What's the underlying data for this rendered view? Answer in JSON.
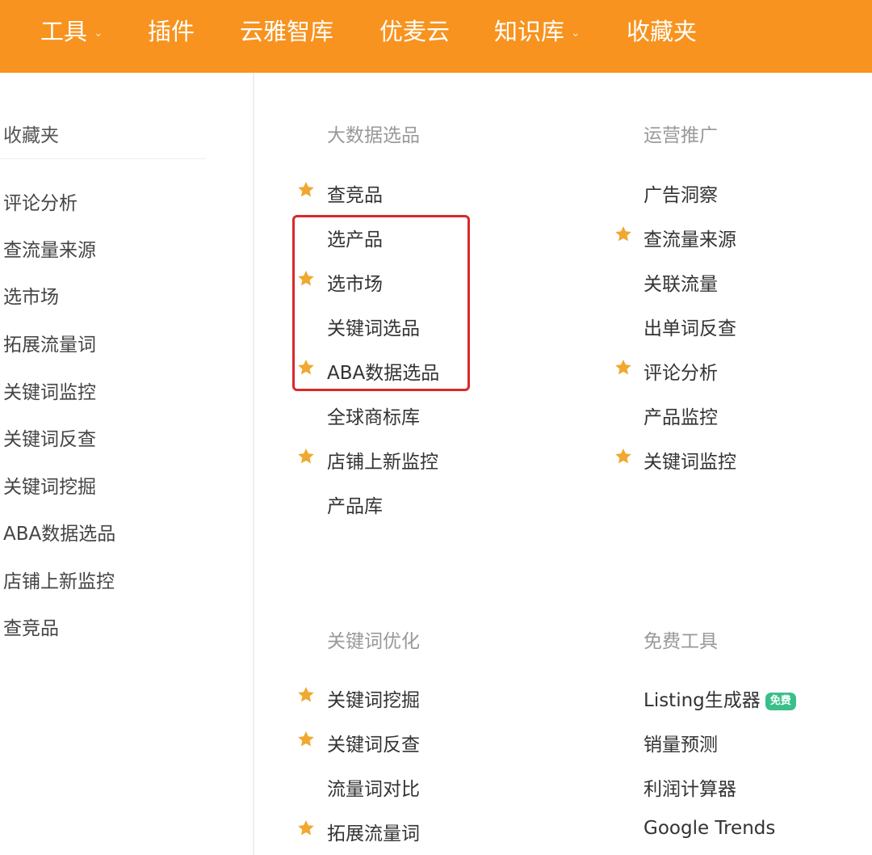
{
  "nav": {
    "items": [
      {
        "label": "工具",
        "dropdown": true
      },
      {
        "label": "插件",
        "dropdown": false
      },
      {
        "label": "云雅智库",
        "dropdown": false
      },
      {
        "label": "优麦云",
        "dropdown": false
      },
      {
        "label": "知识库",
        "dropdown": true
      },
      {
        "label": "收藏夹",
        "dropdown": false
      }
    ],
    "caret": "⌄",
    "bg_color": "#f7931e"
  },
  "favorites": {
    "title": "收藏夹",
    "items": [
      "评论分析",
      "查流量来源",
      "选市场",
      "拓展流量词",
      "关键词监控",
      "关键词反查",
      "关键词挖掘",
      "ABA数据选品",
      "店铺上新监控",
      "查竞品"
    ]
  },
  "sections": [
    {
      "title": "大数据选品",
      "items": [
        {
          "label": "查竞品",
          "starred": true
        },
        {
          "label": "选产品",
          "starred": false
        },
        {
          "label": "选市场",
          "starred": true
        },
        {
          "label": "关键词选品",
          "starred": false
        },
        {
          "label": "ABA数据选品",
          "starred": true
        },
        {
          "label": "全球商标库",
          "starred": false
        },
        {
          "label": "店铺上新监控",
          "starred": true
        },
        {
          "label": "产品库",
          "starred": false
        }
      ]
    },
    {
      "title": "运营推广",
      "items": [
        {
          "label": "广告洞察",
          "starred": false
        },
        {
          "label": "查流量来源",
          "starred": true
        },
        {
          "label": "关联流量",
          "starred": false
        },
        {
          "label": "出单词反查",
          "starred": false
        },
        {
          "label": "评论分析",
          "starred": true
        },
        {
          "label": "产品监控",
          "starred": false
        },
        {
          "label": "关键词监控",
          "starred": true
        }
      ]
    },
    {
      "title": "关键词优化",
      "items": [
        {
          "label": "关键词挖掘",
          "starred": true
        },
        {
          "label": "关键词反查",
          "starred": true
        },
        {
          "label": "流量词对比",
          "starred": false
        },
        {
          "label": "拓展流量词",
          "starred": true
        }
      ]
    },
    {
      "title": "免费工具",
      "items": [
        {
          "label": "Listing生成器",
          "starred": false,
          "badge": "免费"
        },
        {
          "label": "销量预测",
          "starred": false
        },
        {
          "label": "利润计算器",
          "starred": false
        },
        {
          "label": "Google Trends",
          "starred": false
        }
      ]
    }
  ],
  "colors": {
    "star": "#f0a830",
    "highlight": "#d9292a",
    "badge": "#3bbf8a"
  },
  "icons": {
    "star": "star-icon",
    "caret": "chevron-down-icon"
  }
}
